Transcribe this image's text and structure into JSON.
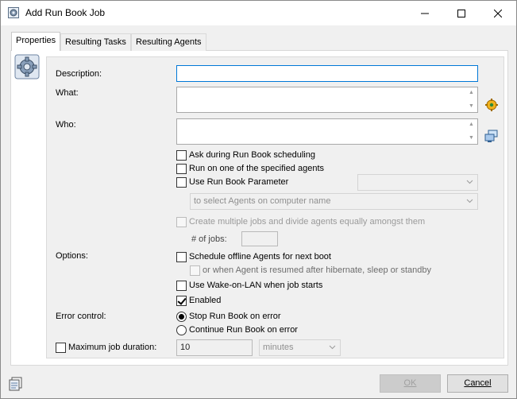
{
  "window": {
    "title": "Add Run Book Job"
  },
  "tabs": [
    {
      "label": "Properties",
      "active": true
    },
    {
      "label": "Resulting Tasks",
      "active": false
    },
    {
      "label": "Resulting Agents",
      "active": false
    }
  ],
  "form": {
    "description_label": "Description:",
    "description_value": "",
    "what_label": "What:",
    "who_label": "Who:",
    "ask_during_scheduling": {
      "label": "Ask during Run Book scheduling",
      "checked": false
    },
    "run_on_one_agent": {
      "label": "Run on one of the specified agents",
      "checked": false
    },
    "use_runbook_parameter": {
      "label": "Use Run Book Parameter",
      "checked": false
    },
    "parameter_combo_value": "",
    "agent_select_combo": "to select Agents on computer name",
    "create_multiple_jobs": {
      "label": "Create multiple jobs and divide agents equally amongst them",
      "checked": false,
      "enabled": false
    },
    "num_jobs_label": "# of jobs:",
    "num_jobs_value": "",
    "options_label": "Options:",
    "schedule_offline": {
      "label": "Schedule offline Agents for next boot",
      "checked": false
    },
    "or_when_resumed": {
      "label": "or when Agent is resumed after hibernate, sleep or standby",
      "checked": false,
      "enabled": false
    },
    "wake_on_lan": {
      "label": "Use Wake-on-LAN when job starts",
      "checked": false
    },
    "enabled": {
      "label": "Enabled",
      "checked": true
    },
    "error_control_label": "Error control:",
    "stop_on_error": {
      "label": "Stop Run Book on error",
      "selected": true
    },
    "continue_on_error": {
      "label": "Continue Run Book on error",
      "selected": false
    },
    "max_duration": {
      "label": "Maximum job duration:",
      "checked": false
    },
    "duration_value": "10",
    "duration_unit": "minutes"
  },
  "buttons": {
    "ok": "OK",
    "cancel": "Cancel"
  },
  "icons": {
    "app": "gear-document-icon",
    "properties": "gear-icon",
    "what_action": "runbook-select-icon",
    "who_action": "computers-select-icon",
    "bottom": "document-list-icon"
  }
}
